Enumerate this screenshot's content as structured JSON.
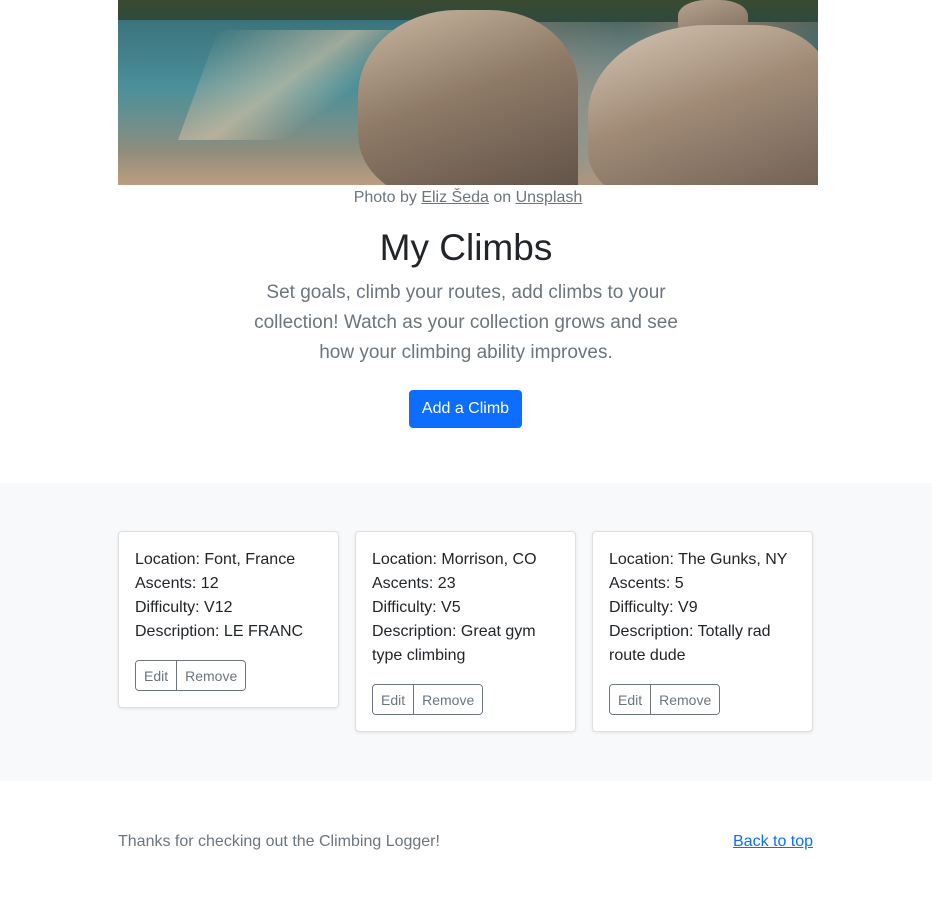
{
  "hero": {
    "image_alt": "Rocks beside a mountain lake",
    "credit": {
      "prefix": "Photo by ",
      "author": "Eliz Šeda",
      "middle": " on ",
      "site": "Unsplash"
    }
  },
  "header": {
    "title": "My Climbs",
    "lead": "Set goals, climb your routes, add climbs to your collection! Watch as your collection grows and see how your climbing ability improves.",
    "add_button_label": "Add a Climb"
  },
  "cards": [
    {
      "location": "Location: Font, France",
      "ascents": "Ascents: 12",
      "difficulty": "Difficulty: V12",
      "description": "Description: LE FRANC",
      "edit_label": "Edit",
      "remove_label": "Remove"
    },
    {
      "location": "Location: Morrison, CO",
      "ascents": "Ascents: 23",
      "difficulty": "Difficulty: V5",
      "description": "Description: Great gym type climbing",
      "edit_label": "Edit",
      "remove_label": "Remove"
    },
    {
      "location": "Location: The Gunks, NY",
      "ascents": "Ascents: 5",
      "difficulty": "Difficulty: V9",
      "description": "Description: Totally rad route dude",
      "edit_label": "Edit",
      "remove_label": "Remove"
    }
  ],
  "footer": {
    "text": "Thanks for checking out the Climbing Logger!",
    "back_to_top": "Back to top"
  },
  "colors": {
    "primary": "#0d6efd",
    "muted": "#6c757d",
    "album_bg": "#f8f9fa"
  }
}
